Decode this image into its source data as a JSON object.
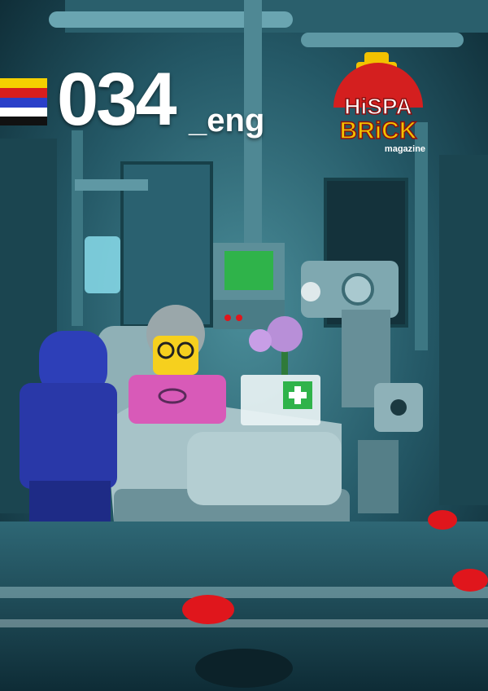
{
  "cover": {
    "issue_number": "034",
    "issue_suffix": "_eng",
    "flag_colors": [
      "#f5d000",
      "#d81e1e",
      "#2a3fc9",
      "#ffffff",
      "#111111"
    ]
  },
  "logo": {
    "line1": "HiSPA",
    "line2": "BRiCK",
    "tagline": "magazine",
    "colors": {
      "red": "#d41f1f",
      "yellow": "#f2c200",
      "white": "#ffffff"
    }
  },
  "scene": {
    "accent_colors": {
      "figure_shirt": "#d85ab8",
      "astronaut": "#2d3fb8",
      "screen_green": "#2fb34a",
      "button_red": "#e0161c",
      "room_teal": "#3a7f8c"
    }
  }
}
